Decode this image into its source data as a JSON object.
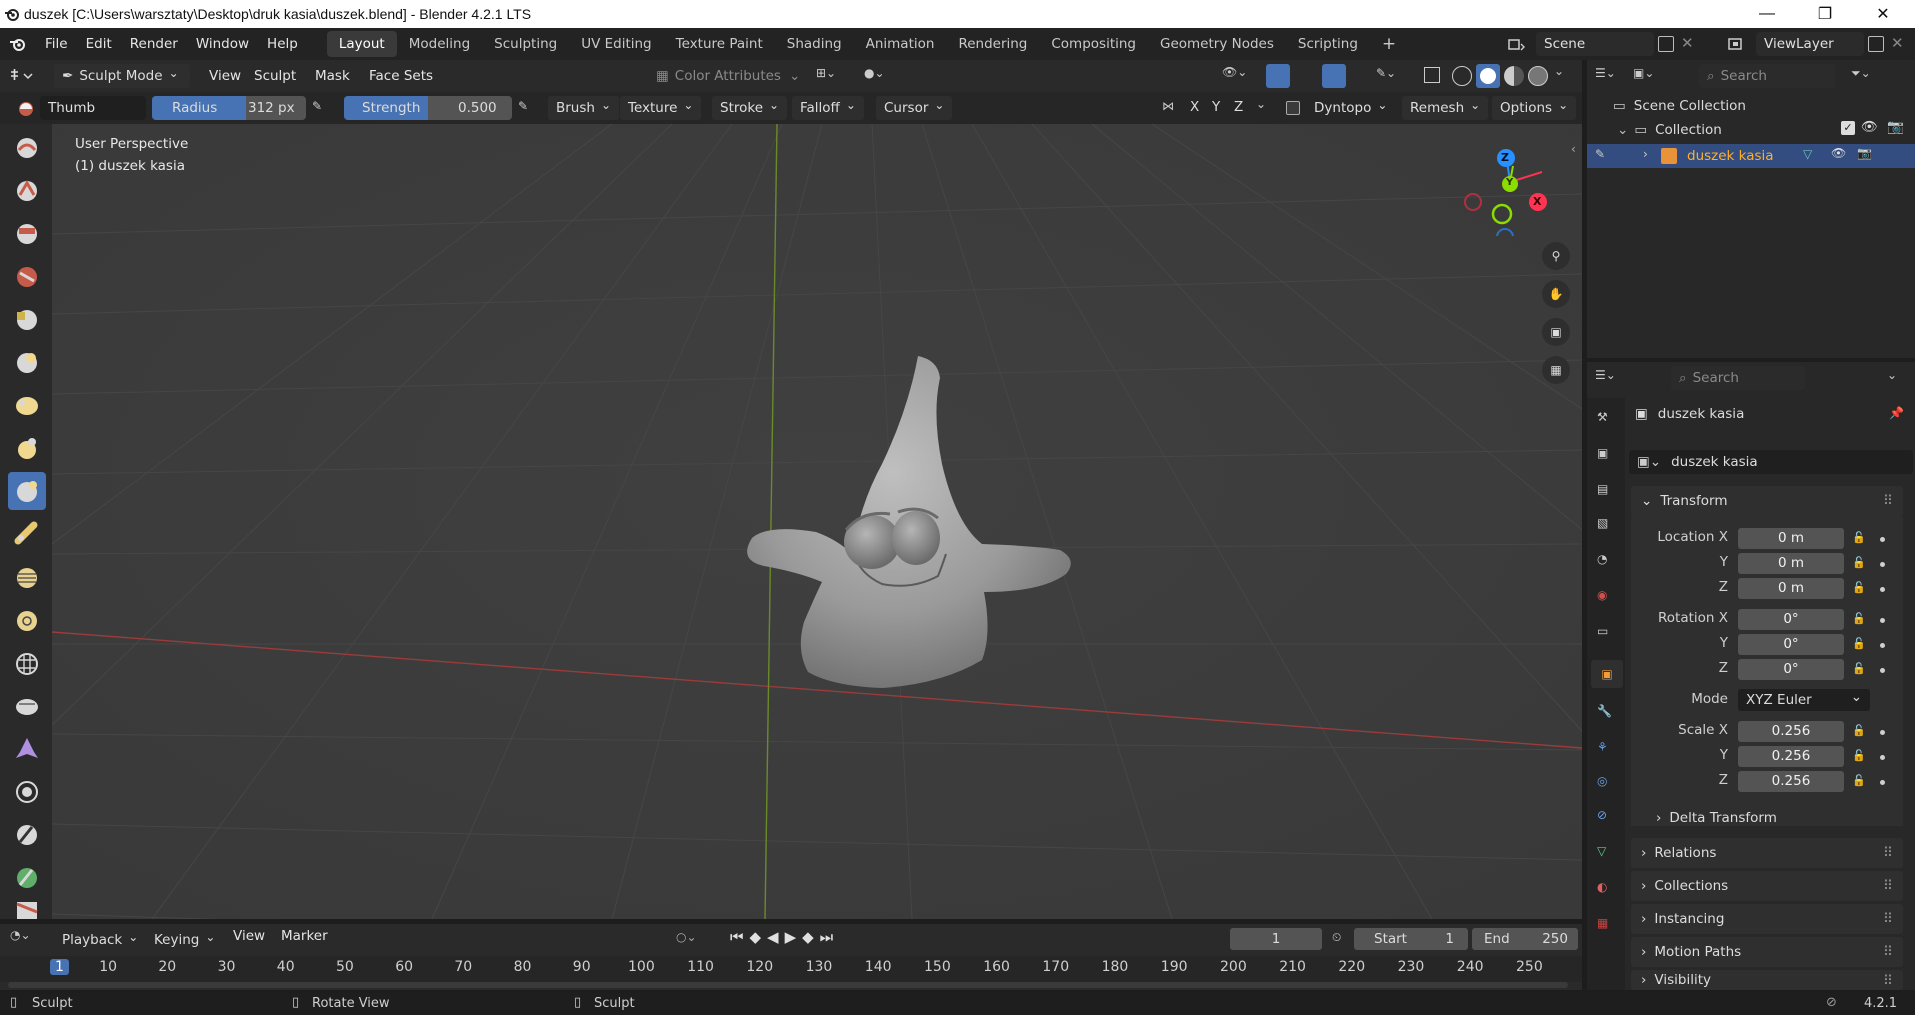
{
  "window": {
    "title": "duszek [C:\\Users\\warsztaty\\Desktop\\druk kasia\\duszek.blend] - Blender 4.2.1 LTS"
  },
  "menus": [
    "File",
    "Edit",
    "Render",
    "Window",
    "Help"
  ],
  "workspaces": [
    "Layout",
    "Modeling",
    "Sculpting",
    "UV Editing",
    "Texture Paint",
    "Shading",
    "Animation",
    "Rendering",
    "Compositing",
    "Geometry Nodes",
    "Scripting"
  ],
  "active_workspace": "Layout",
  "scene": {
    "name": "Scene",
    "view_layer": "ViewLayer"
  },
  "header": {
    "mode": "Sculpt Mode",
    "menus": [
      "View",
      "Sculpt",
      "Mask",
      "Face Sets"
    ],
    "color_attributes": "Color Attributes"
  },
  "tool_settings": {
    "brush_name": "Thumb",
    "radius_label": "Radius",
    "radius_value": "312 px",
    "strength_label": "Strength",
    "strength_value": "0.500",
    "strength_fraction": 0.5,
    "menus": [
      "Brush",
      "Texture",
      "Stroke",
      "Falloff",
      "Cursor"
    ],
    "axes": [
      "X",
      "Y",
      "Z"
    ],
    "dyntopo": "Dyntopo",
    "remesh": "Remesh",
    "options": "Options"
  },
  "viewport": {
    "perspective": "User Perspective",
    "object_label": "(1) duszek kasia"
  },
  "outliner": {
    "search_placeholder": "Search",
    "scene_collection": "Scene Collection",
    "collection": "Collection",
    "object": "duszek kasia"
  },
  "properties": {
    "search_placeholder": "Search",
    "object_name": "duszek kasia",
    "data_name": "duszek kasia",
    "transform_label": "Transform",
    "location_label": "Location X",
    "location": [
      "0 m",
      "0 m",
      "0 m"
    ],
    "rotation_label": "Rotation X",
    "rotation": [
      "0°",
      "0°",
      "0°"
    ],
    "mode_label": "Mode",
    "mode_value": "XYZ Euler",
    "scale_label": "Scale X",
    "scale": [
      "0.256",
      "0.256",
      "0.256"
    ],
    "axis_y": "Y",
    "axis_z": "Z",
    "delta_transform": "Delta Transform",
    "panels": [
      "Relations",
      "Collections",
      "Instancing",
      "Motion Paths",
      "Visibility"
    ]
  },
  "timeline": {
    "menus": [
      "Playback",
      "Keying",
      "View",
      "Marker"
    ],
    "current_frame": "1",
    "start_label": "Start",
    "start": "1",
    "end_label": "End",
    "end": "250",
    "ticks": [
      "1",
      "10",
      "20",
      "30",
      "40",
      "50",
      "60",
      "70",
      "80",
      "90",
      "100",
      "110",
      "120",
      "130",
      "140",
      "150",
      "160",
      "170",
      "180",
      "190",
      "200",
      "210",
      "220",
      "230",
      "240",
      "250"
    ]
  },
  "statusbar": {
    "left": "Sculpt",
    "middle": "Rotate View",
    "right": "Sculpt",
    "version": "4.2.1"
  },
  "gizmo": {
    "x": "X",
    "y": "Y",
    "z": "Z"
  },
  "colors": {
    "accent": "#4772b3",
    "selection": "#334d80",
    "object_name": "#ffaf29",
    "axis_x": "#ff3352",
    "axis_y": "#8bdc00",
    "axis_z": "#2890ff"
  }
}
